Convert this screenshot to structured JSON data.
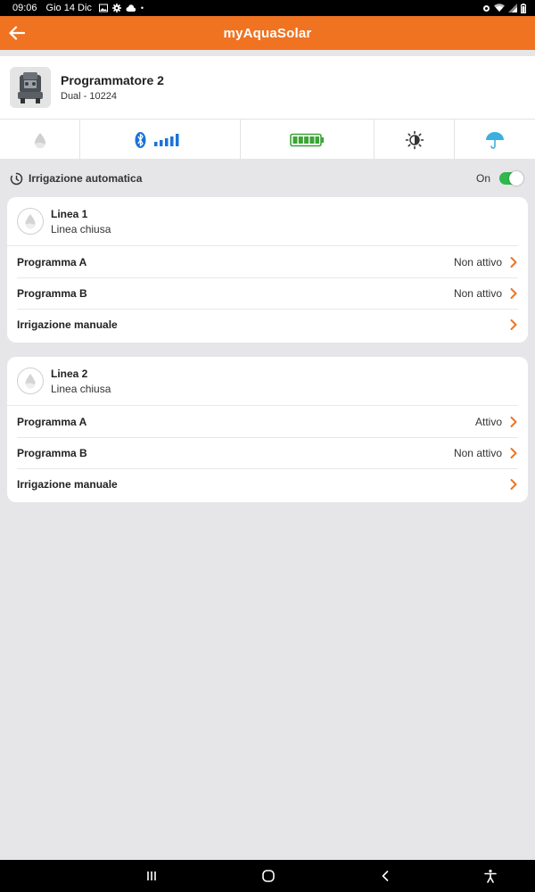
{
  "status_bar": {
    "time": "09:06",
    "date": "Gio 14 Dic",
    "icons": [
      "image-icon",
      "gear-icon",
      "cloud-icon",
      "dot-icon"
    ],
    "right_icons": [
      "alarm-icon",
      "wifi-icon",
      "signal-icon",
      "battery-icon"
    ]
  },
  "app_bar": {
    "title": "myAquaSolar",
    "background": "#f07322"
  },
  "device": {
    "name": "Programmatore 2",
    "model": "Dual - 10224"
  },
  "status_tiles": [
    {
      "icon": "water-drop-icon"
    },
    {
      "icon": "bluetooth-signal-icon"
    },
    {
      "icon": "battery-full-icon"
    },
    {
      "icon": "brightness-icon"
    },
    {
      "icon": "umbrella-icon"
    }
  ],
  "auto_irrigation": {
    "label": "Irrigazione automatica",
    "state_label": "On",
    "enabled": true
  },
  "lines": [
    {
      "name": "Linea 1",
      "state": "Linea chiusa",
      "rows": [
        {
          "label": "Programma A",
          "value": "Non attivo"
        },
        {
          "label": "Programma B",
          "value": "Non attivo"
        },
        {
          "label": "Irrigazione manuale",
          "value": ""
        }
      ]
    },
    {
      "name": "Linea 2",
      "state": "Linea chiusa",
      "rows": [
        {
          "label": "Programma A",
          "value": "Attivo"
        },
        {
          "label": "Programma B",
          "value": "Non attivo"
        },
        {
          "label": "Irrigazione manuale",
          "value": ""
        }
      ]
    }
  ],
  "colors": {
    "accent": "#f07322",
    "bluetooth": "#1a73d9",
    "battery": "#3aa535",
    "toggle_on": "#2fb84b",
    "umbrella": "#3bb0e0"
  },
  "nav_bar": {
    "buttons": [
      "recents-icon",
      "home-icon",
      "back-icon",
      "accessibility-icon"
    ]
  }
}
